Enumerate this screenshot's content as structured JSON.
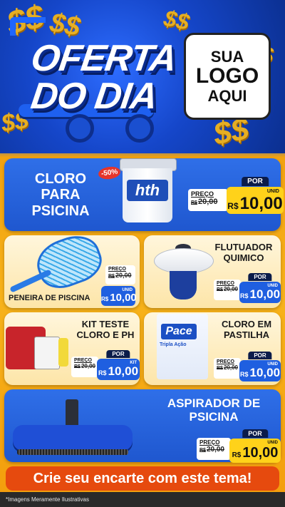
{
  "header": {
    "title_line1": "OFERTA",
    "title_line2": "DO DIA",
    "logo": {
      "line1": "SUA",
      "line2": "LOGO",
      "line3": "AQUI"
    },
    "decor_symbol": "$$"
  },
  "products": [
    {
      "id": "cloro",
      "title": "CLORO\nPARA\nPSICINA",
      "discount_badge": "-50%",
      "brand_text": "hth",
      "old_label": "PREÇO",
      "old_currency": "R$",
      "old_price": "20,00",
      "new_label": "POR",
      "new_currency": "R$",
      "new_price": "10,00",
      "unit": "UNID"
    },
    {
      "id": "peneira",
      "title": "PENEIRA DE PISCINA",
      "old_label": "PREÇO",
      "old_currency": "R$",
      "old_price": "20,00",
      "new_label": "",
      "new_currency": "R$",
      "new_price": "10,00",
      "unit": "UNID"
    },
    {
      "id": "flutuador",
      "title": "FLUTUADOR\nQUIMICO",
      "old_label": "PREÇO",
      "old_currency": "R$",
      "old_price": "20,00",
      "new_label": "POR",
      "new_currency": "R$",
      "new_price": "10,00",
      "unit": "UNID"
    },
    {
      "id": "kit",
      "title": "KIT TESTE\nCLORO E PH",
      "old_label": "PREÇO",
      "old_currency": "R$",
      "old_price": "20,00",
      "new_label": "POR",
      "new_currency": "R$",
      "new_price": "10,00",
      "unit": "KIT"
    },
    {
      "id": "pastilha",
      "title": "CLORO EM\nPASTILHA",
      "brand_text": "Pace",
      "sub_text": "Tripla Ação",
      "old_label": "PREÇO",
      "old_currency": "R$",
      "old_price": "20,00",
      "new_label": "POR",
      "new_currency": "R$",
      "new_price": "10,00",
      "unit": "UNID"
    },
    {
      "id": "aspirador",
      "title": "ASPIRADOR DE\nPSICINA",
      "old_label": "PREÇO",
      "old_currency": "R$",
      "old_price": "20,00",
      "new_label": "POR",
      "new_currency": "R$",
      "new_price": "10,00",
      "unit": "UNID"
    }
  ],
  "cta": "Crie seu encarte com este tema!",
  "footer": "*Imagens Meramente Ilustrativas",
  "colors": {
    "blue": "#1f57cf",
    "yellow": "#ffd21a",
    "orange": "#e64a0e",
    "cream": "#fff6dc"
  }
}
